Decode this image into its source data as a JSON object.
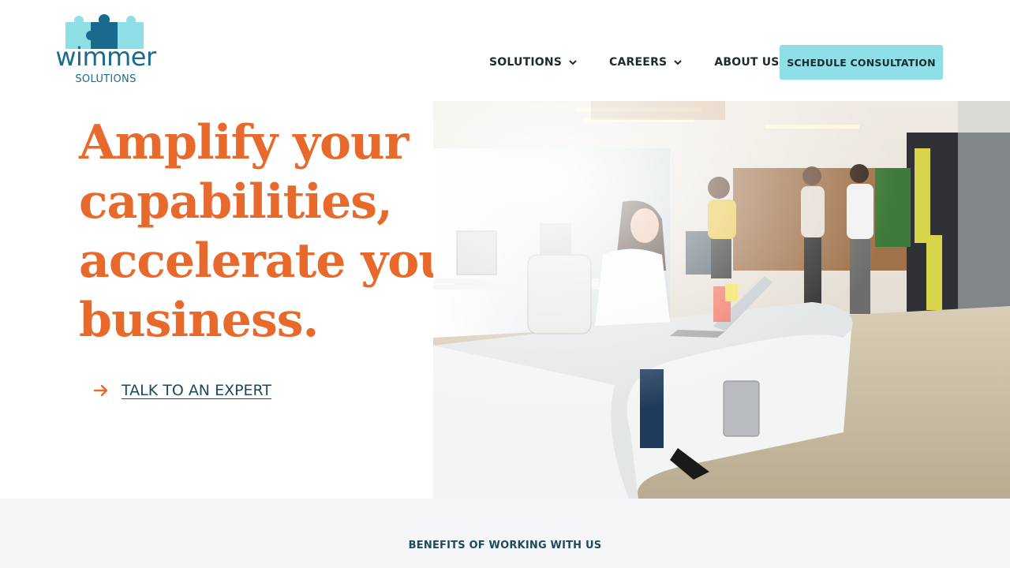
{
  "brand": {
    "name": "wimmer",
    "tagline": "SOLUTIONS",
    "colors": {
      "primary": "#1a6a8e",
      "accent": "#e8692c",
      "cta": "#8fdfe6",
      "light_puzzle": "#8fdfe6"
    }
  },
  "nav": {
    "items": [
      {
        "label": "SOLUTIONS",
        "icon": "chevron-down-icon"
      },
      {
        "label": "CAREERS",
        "icon": "chevron-down-icon"
      },
      {
        "label": "ABOUT US",
        "icon": "chevron-down-icon"
      }
    ],
    "cta_label": "SCHEDULE CONSULTATION"
  },
  "hero": {
    "headline_lines": [
      "Amplify your",
      "capabilities,",
      "accelerate your",
      "business."
    ],
    "link_label": "TALK TO AN EXPERT",
    "link_icon": "arrow-right-icon",
    "image": "office-worker-at-desk-photo"
  },
  "benefits": {
    "title": "BENEFITS OF WORKING WITH US"
  }
}
